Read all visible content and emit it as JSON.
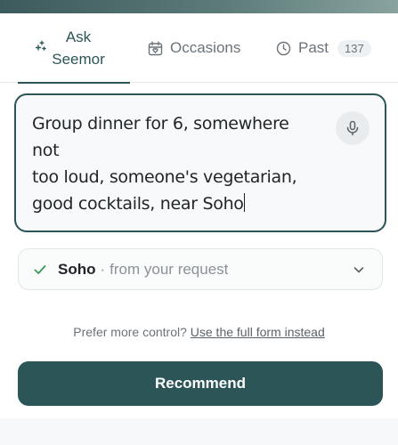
{
  "tabs": {
    "ask": {
      "line1": "Ask",
      "line2": "Seemor",
      "icon": "sparkle-icon"
    },
    "occasions": {
      "label": "Occasions",
      "icon": "calendar-heart-icon"
    },
    "past": {
      "label": "Past",
      "count": "137",
      "icon": "clock-icon"
    }
  },
  "request": {
    "line1": "Group dinner for 6, somewhere not",
    "line2": "too loud, someone's vegetarian,",
    "line3": "good cocktails, near Soho",
    "mic_icon": "microphone-icon"
  },
  "location": {
    "name": "Soho",
    "separator": "·",
    "source": "from your request",
    "check_icon": "check-icon",
    "chevron_icon": "chevron-down-icon"
  },
  "form_prompt": {
    "text": "Prefer more control?",
    "link": "Use the full form instead"
  },
  "recommend": {
    "label": "Recommend"
  },
  "colors": {
    "accent": "#2b5557",
    "check_green": "#3a9a55",
    "muted_text": "#6b7378"
  }
}
